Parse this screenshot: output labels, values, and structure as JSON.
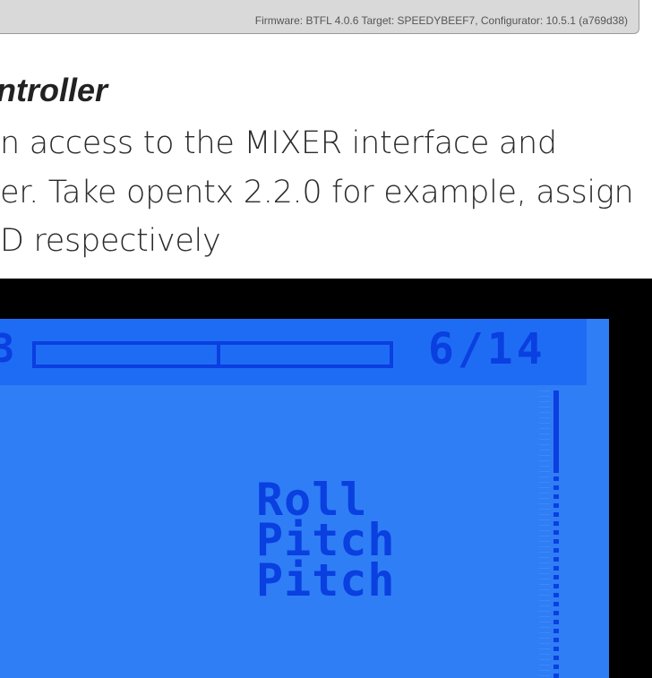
{
  "status_bar": {
    "firmware_text": "Firmware: BTFL 4.0.6 Target: SPEEDYBEEF7, Configurator: 10.5.1 (a769d38)"
  },
  "article": {
    "heading_fragment": "ntroller",
    "paragraph_lines": [
      "n access to the MIXER interface and",
      "er. Take opentx 2.2.0 for example, assign",
      "D respectively"
    ]
  },
  "lcd_screen": {
    "header_left_fragment": "3",
    "page_indicator": "6/14",
    "channels": [
      "Roll",
      "Pitch",
      "Pitch"
    ]
  },
  "colors": {
    "lcd_background": "#2f7ef6",
    "lcd_header": "#1f6cf4",
    "lcd_pixel": "#0a3fe0",
    "frame": "#000000"
  }
}
